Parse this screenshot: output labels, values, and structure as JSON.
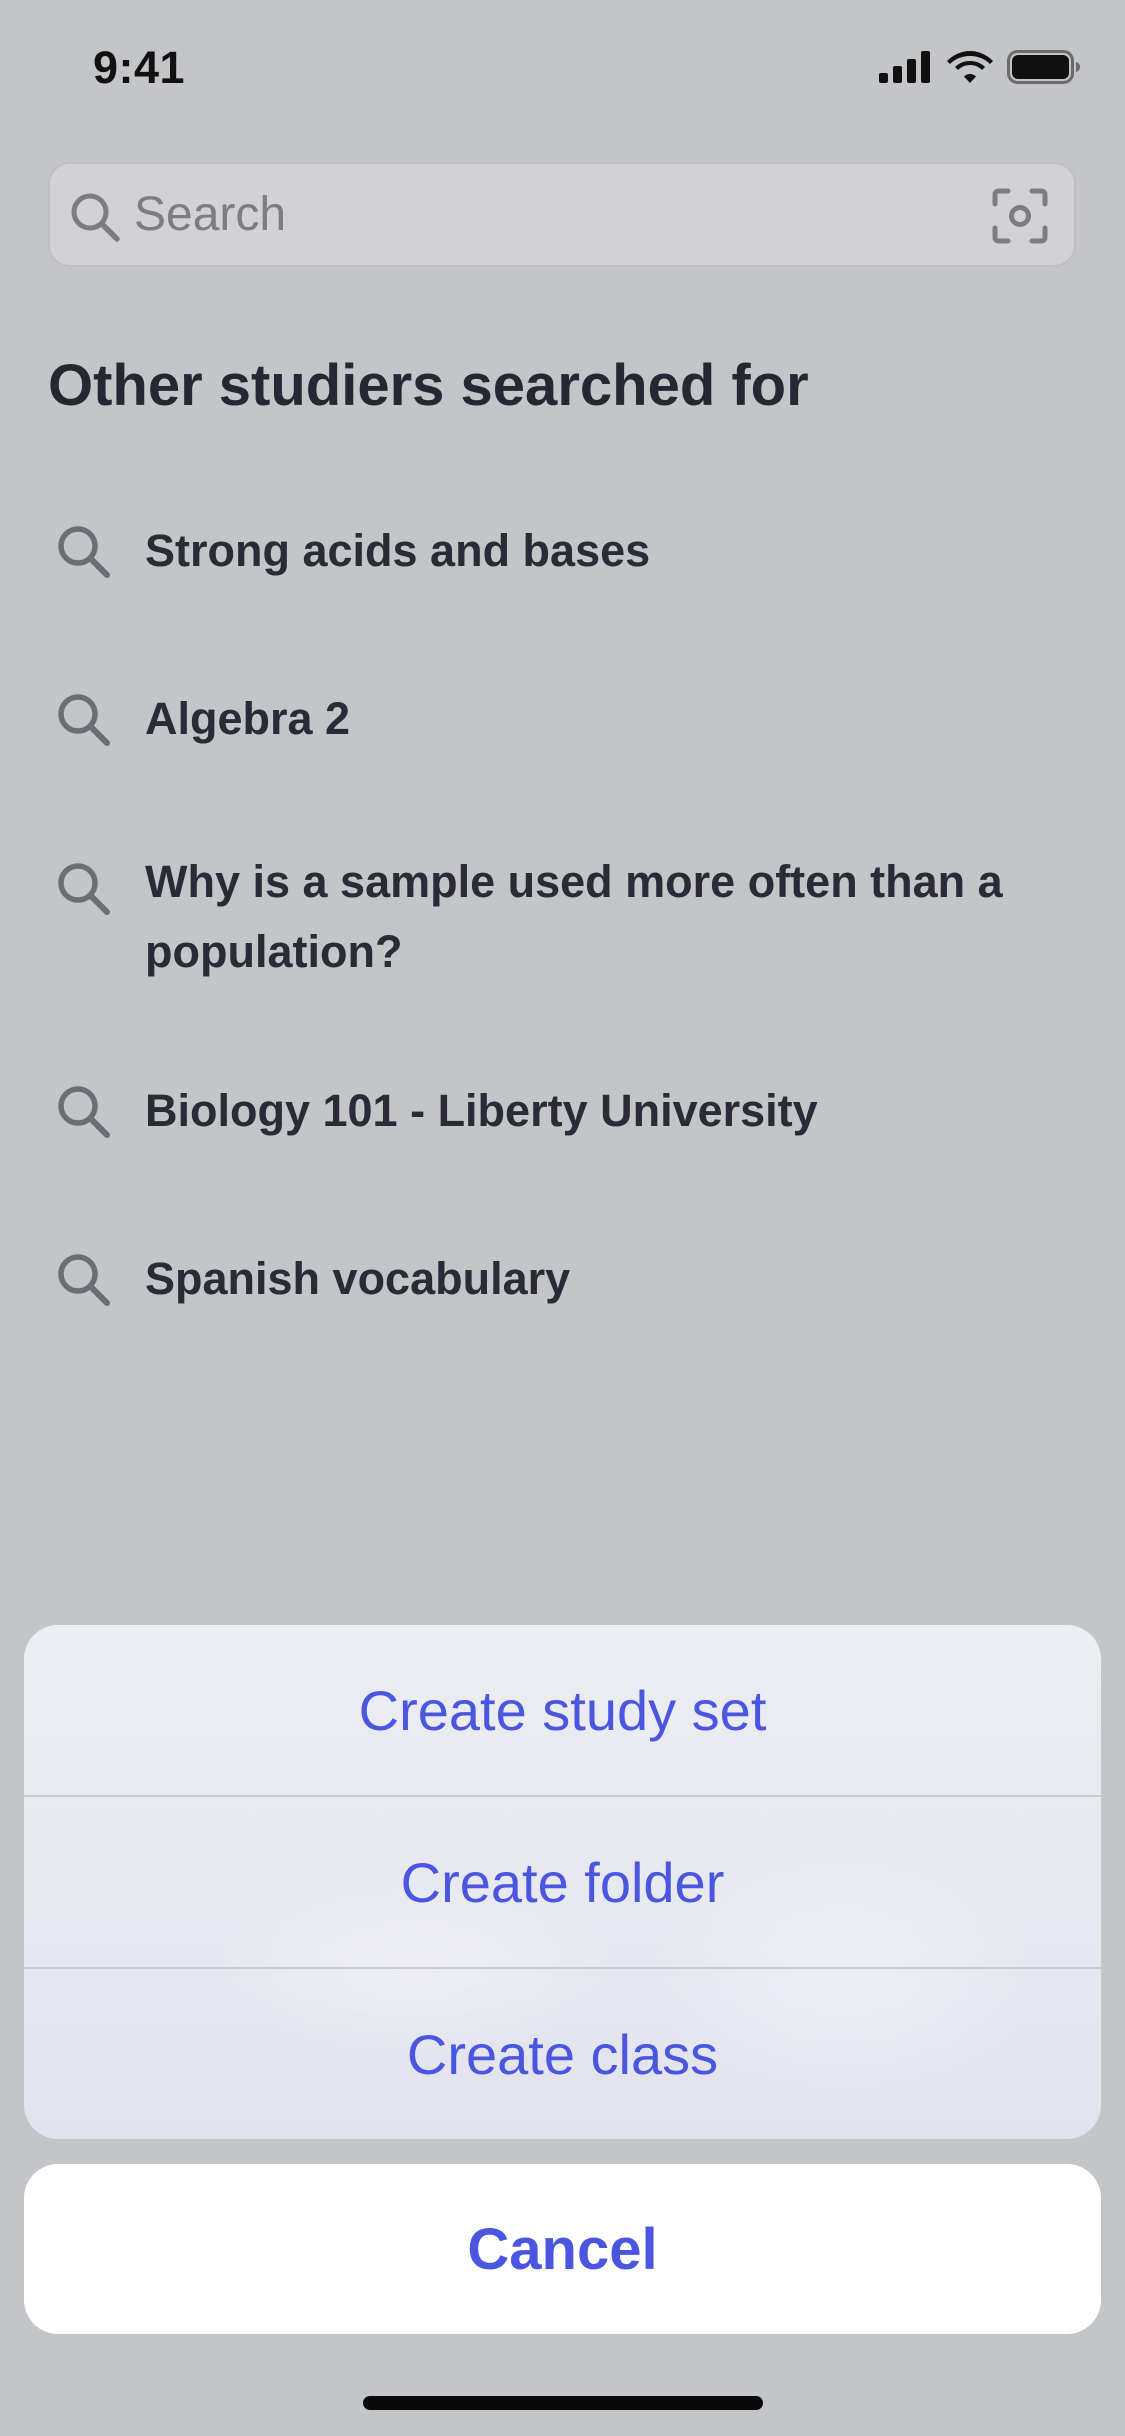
{
  "status_bar": {
    "time": "9:41",
    "icons": [
      "cellular-signal-icon",
      "wifi-icon",
      "battery-icon"
    ]
  },
  "search": {
    "placeholder": "Search",
    "value": "",
    "icon": "search-icon",
    "scan_icon": "scan-camera-icon"
  },
  "suggestions": {
    "title": "Other studiers searched for",
    "items": [
      {
        "label": "Strong acids and bases",
        "icon": "search-icon"
      },
      {
        "label": "Algebra 2",
        "icon": "search-icon"
      },
      {
        "label": "Why is a sample used more often than a population?",
        "icon": "search-icon"
      },
      {
        "label": "Biology 101 - Liberty University",
        "icon": "search-icon"
      },
      {
        "label": "Spanish vocabulary",
        "icon": "search-icon"
      }
    ]
  },
  "action_sheet": {
    "items": [
      {
        "label": "Create study set"
      },
      {
        "label": "Create folder"
      },
      {
        "label": "Create class"
      }
    ],
    "cancel_label": "Cancel"
  },
  "colors": {
    "background": "#c4c5c9",
    "accent": "#4a55e0",
    "text": "#2a2b36"
  }
}
